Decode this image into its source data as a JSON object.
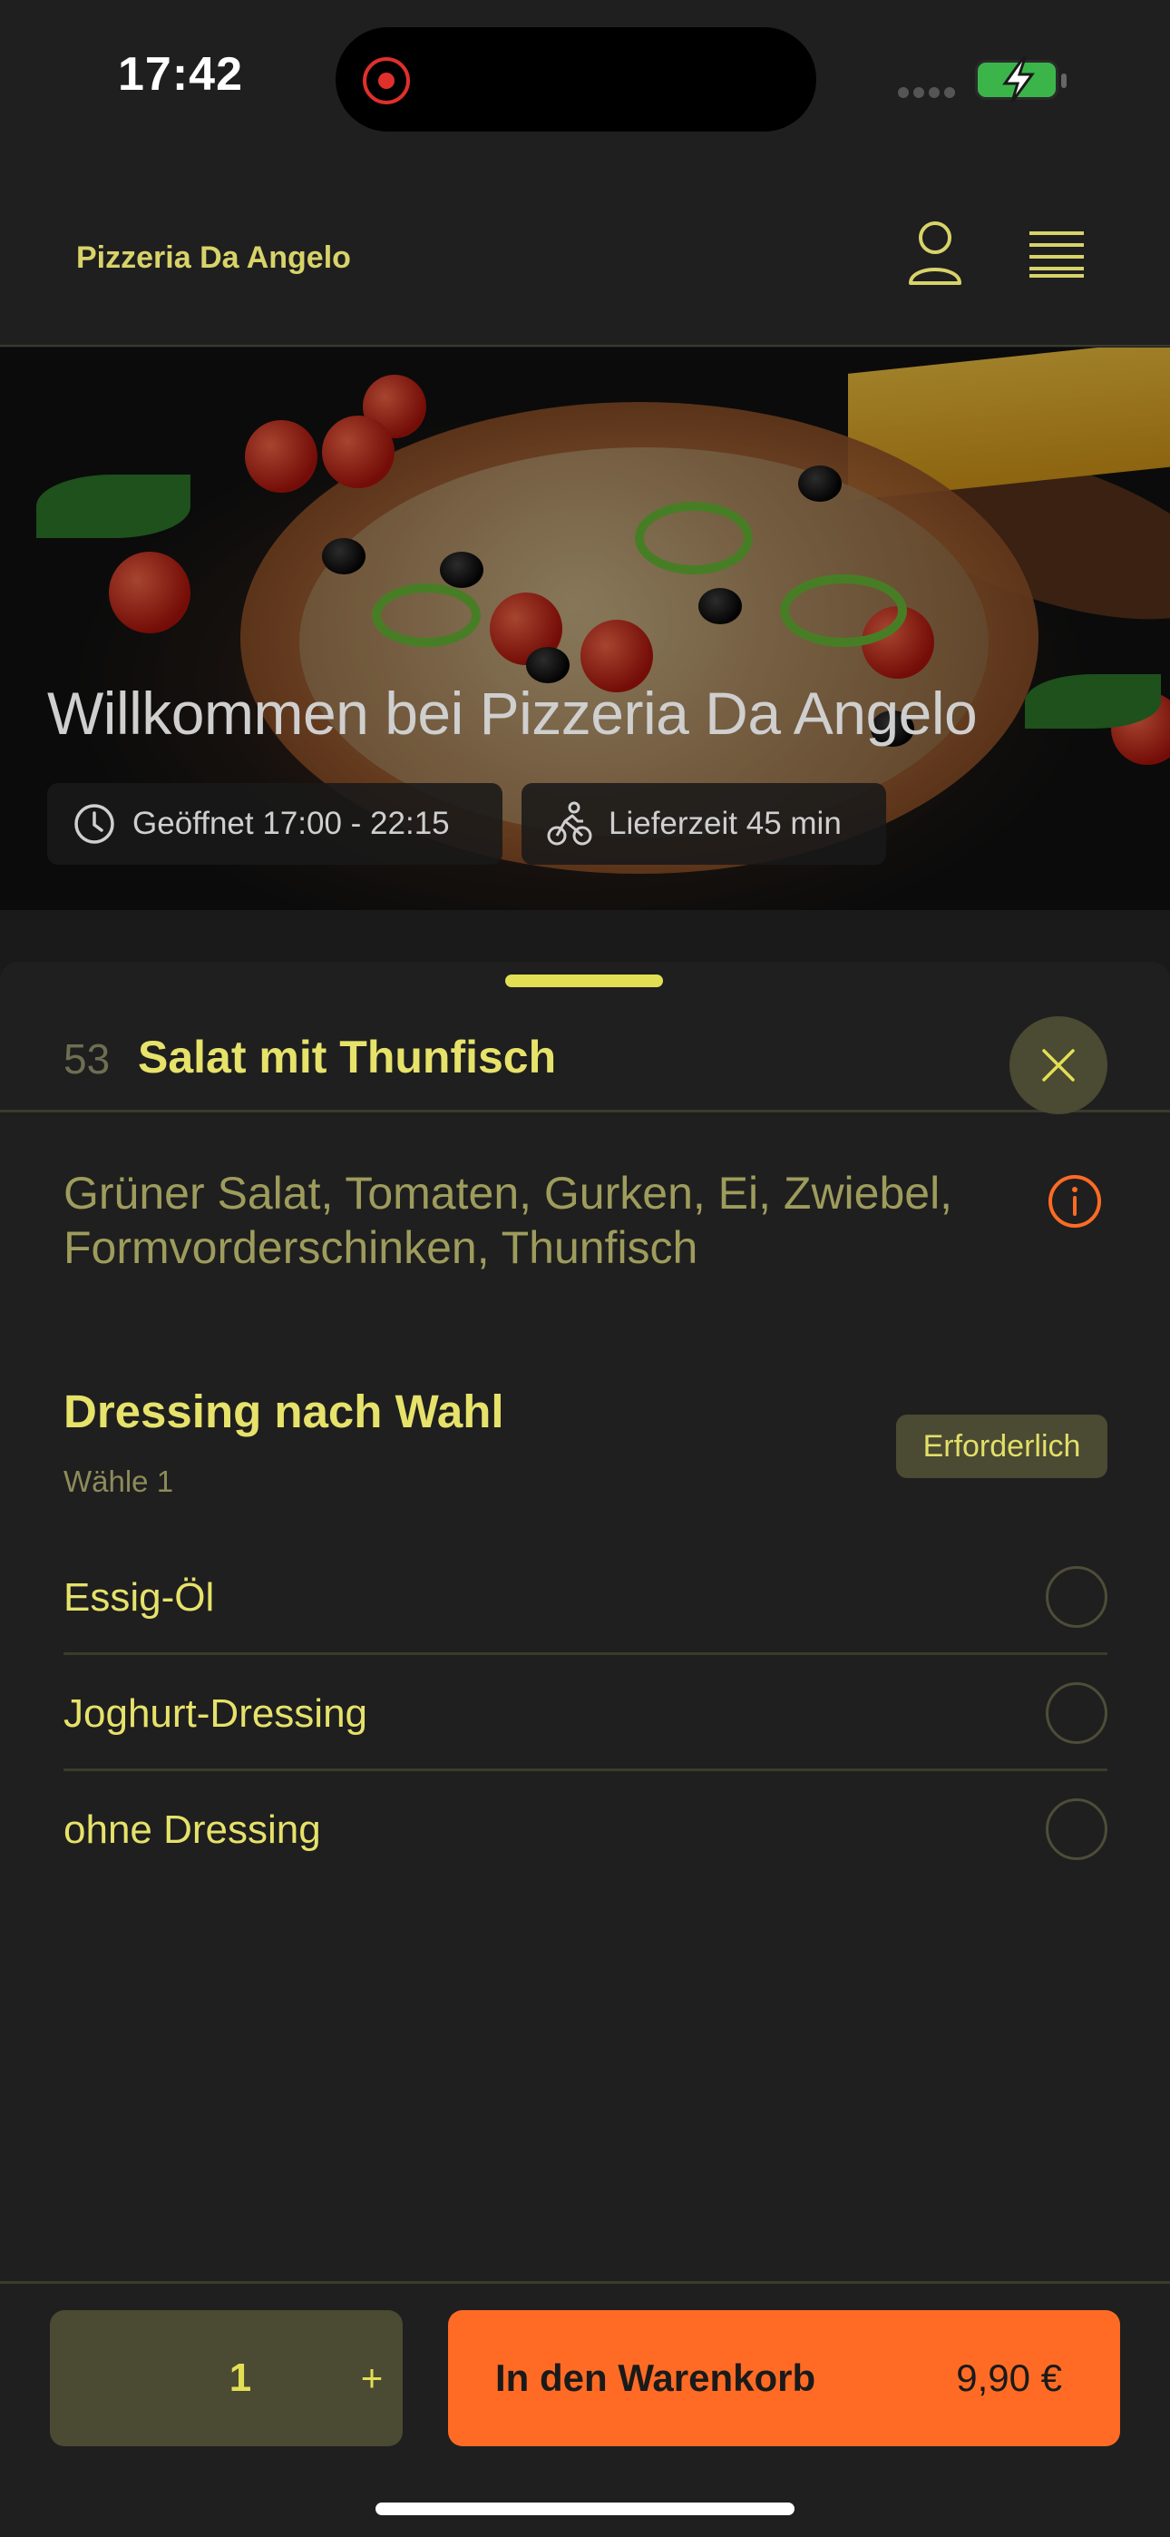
{
  "status_bar": {
    "time": "17:42"
  },
  "header": {
    "brand": "Pizzeria Da Angelo"
  },
  "hero": {
    "title": "Willkommen bei Pizzeria Da Angelo",
    "opening_hours": "Geöffnet 17:00 - 22:15",
    "delivery_time": "Lieferzeit 45 min"
  },
  "item": {
    "number": "53",
    "title": "Salat mit Thunfisch",
    "description": "Grüner Salat, Tomaten, Gurken, Ei, Zwiebel, Formvorderschinken, Thunfisch"
  },
  "option_group": {
    "title": "Dressing nach Wahl",
    "subtitle": "Wähle 1",
    "badge": "Erforderlich",
    "options": [
      {
        "label": "Essig-Öl"
      },
      {
        "label": "Joghurt-Dressing"
      },
      {
        "label": "ohne Dressing"
      }
    ]
  },
  "footer": {
    "quantity": "1",
    "plus_label": "+",
    "add_to_cart": "In den Warenkorb",
    "price": "9,90 €"
  },
  "colors": {
    "accent_yellow": "#e6e26a",
    "accent_orange": "#ff6b24",
    "background": "#1f1f1f",
    "chip_olive": "#4b4a32"
  },
  "icons": [
    "user-icon",
    "menu-icon",
    "clock-icon",
    "bike-icon",
    "close-icon",
    "info-icon"
  ]
}
